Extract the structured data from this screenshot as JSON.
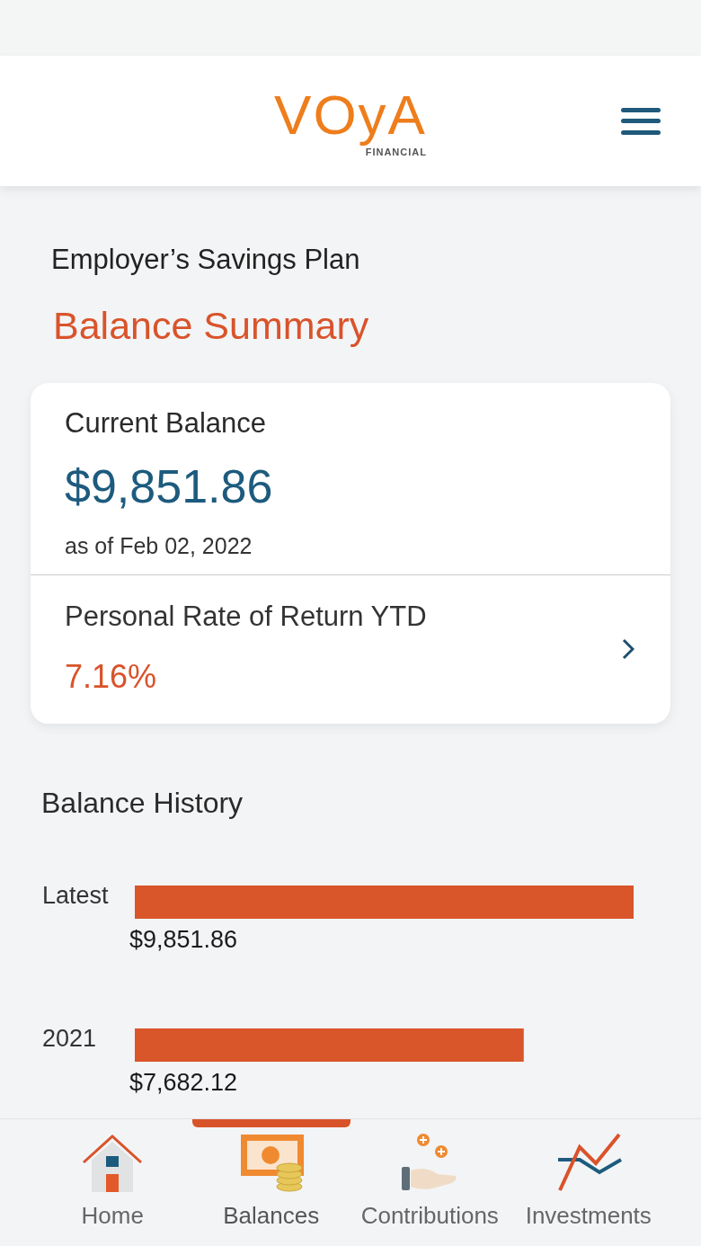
{
  "header": {
    "logo": {
      "wordmark": "VOyA",
      "tagline": "FINANCIAL"
    }
  },
  "plan_name": "Employer’s Savings Plan",
  "page_title": "Balance Summary",
  "balance_card": {
    "label": "Current Balance",
    "amount": "$9,851.86",
    "as_of": "as of Feb 02, 2022",
    "return_label": "Personal Rate of Return YTD",
    "return_value": "7.16%"
  },
  "balance_history": {
    "chart_data": {
      "type": "bar",
      "orientation": "horizontal",
      "title": "Balance History",
      "categories": [
        "Latest",
        "2021"
      ],
      "values": [
        9851.86,
        7682.12
      ],
      "value_labels": [
        "$9,851.86",
        "$7,682.12"
      ]
    }
  },
  "bottom_nav": [
    {
      "label": "Home",
      "kind": "home",
      "selected": false
    },
    {
      "label": "Balances",
      "kind": "balances",
      "selected": true
    },
    {
      "label": "Contributions",
      "kind": "contributions",
      "selected": false
    },
    {
      "label": "Investments",
      "kind": "investments",
      "selected": false
    }
  ]
}
